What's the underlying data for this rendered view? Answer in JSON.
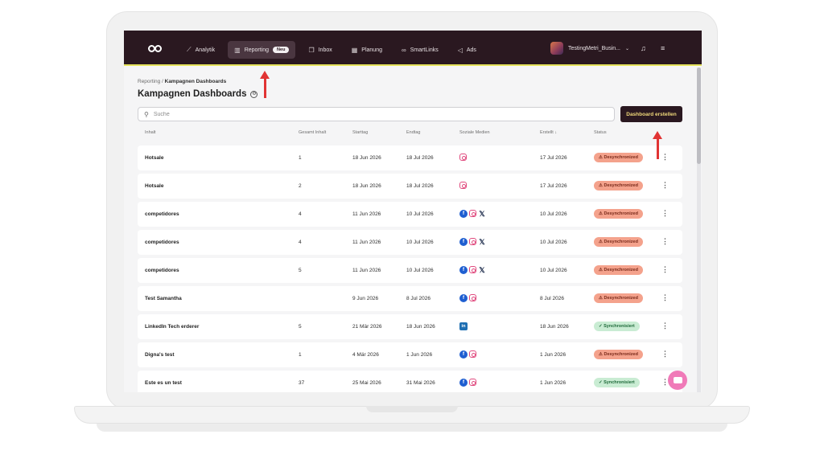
{
  "nav": {
    "items": [
      {
        "label": "Analytik",
        "icon": "chart-line-icon"
      },
      {
        "label": "Reporting",
        "icon": "bar-chart-icon",
        "badge": "Neu",
        "active": true
      },
      {
        "label": "Inbox",
        "icon": "chat-bubbles-icon"
      },
      {
        "label": "Planung",
        "icon": "calendar-icon"
      },
      {
        "label": "SmartLinks",
        "icon": "link-icon"
      },
      {
        "label": "Ads",
        "icon": "megaphone-icon"
      }
    ],
    "account_name": "TestingMetri_Busin..."
  },
  "breadcrumb": {
    "root": "Reporting",
    "separator": "/",
    "current": "Kampagnen Dashboards"
  },
  "page_title": "Kampagnen Dashboards",
  "search": {
    "placeholder": "Suche",
    "value": ""
  },
  "create_button": "Dashboard erstellen",
  "table": {
    "headers": [
      "Inhalt",
      "Gesamt Inhalt",
      "Starttag",
      "Endtag",
      "Soziale Medien",
      "Erstellt",
      "Status"
    ],
    "sort_indicator": "↓",
    "rows": [
      {
        "name": "Hotsale",
        "total": "1",
        "start": "18 Jun 2026",
        "end": "18 Jul 2026",
        "media": [
          "instagram"
        ],
        "created": "17 Jul 2026",
        "status": "Desynchronized",
        "status_type": "bad"
      },
      {
        "name": "Hotsale",
        "total": "2",
        "start": "18 Jun 2026",
        "end": "18 Jul 2026",
        "media": [
          "instagram"
        ],
        "created": "17 Jul 2026",
        "status": "Desynchronized",
        "status_type": "bad"
      },
      {
        "name": "competidores",
        "total": "4",
        "start": "11 Jun 2026",
        "end": "10 Jul 2026",
        "media": [
          "facebook",
          "instagram",
          "x"
        ],
        "created": "10 Jul 2026",
        "status": "Desynchronized",
        "status_type": "bad"
      },
      {
        "name": "competidores",
        "total": "4",
        "start": "11 Jun 2026",
        "end": "10 Jul 2026",
        "media": [
          "facebook",
          "instagram",
          "x"
        ],
        "created": "10 Jul 2026",
        "status": "Desynchronized",
        "status_type": "bad"
      },
      {
        "name": "competidores",
        "total": "5",
        "start": "11 Jun 2026",
        "end": "10 Jul 2026",
        "media": [
          "facebook",
          "instagram",
          "x"
        ],
        "created": "10 Jul 2026",
        "status": "Desynchronized",
        "status_type": "bad"
      },
      {
        "name": "Test Samantha",
        "total": "",
        "start": "9 Jun 2026",
        "end": "8 Jul 2026",
        "media": [
          "facebook",
          "instagram"
        ],
        "created": "8 Jul 2026",
        "status": "Desynchronized",
        "status_type": "bad"
      },
      {
        "name": "LinkedIn Tech erderer",
        "total": "5",
        "start": "21 Mär 2026",
        "end": "18 Jun 2026",
        "media": [
          "linkedin"
        ],
        "created": "18 Jun 2026",
        "status": "Synchronisiert",
        "status_type": "ok"
      },
      {
        "name": "Digna's test",
        "total": "1",
        "start": "4 Mär 2026",
        "end": "1 Jun 2026",
        "media": [
          "facebook",
          "instagram"
        ],
        "created": "1 Jun 2026",
        "status": "Desynchronized",
        "status_type": "bad"
      },
      {
        "name": "Este es un test",
        "total": "37",
        "start": "25 Mai 2026",
        "end": "31 Mai 2026",
        "media": [
          "facebook",
          "instagram"
        ],
        "created": "1 Jun 2026",
        "status": "Synchronisiert",
        "status_type": "ok"
      }
    ]
  },
  "colors": {
    "topbar": "#2a1820",
    "accent_line": "#e4e15a",
    "button_text": "#f0d97a",
    "status_bad": "#f4a28c",
    "status_ok": "#c9ecd3",
    "chat": "#f07ab8",
    "annotation_arrow": "#e13434"
  }
}
